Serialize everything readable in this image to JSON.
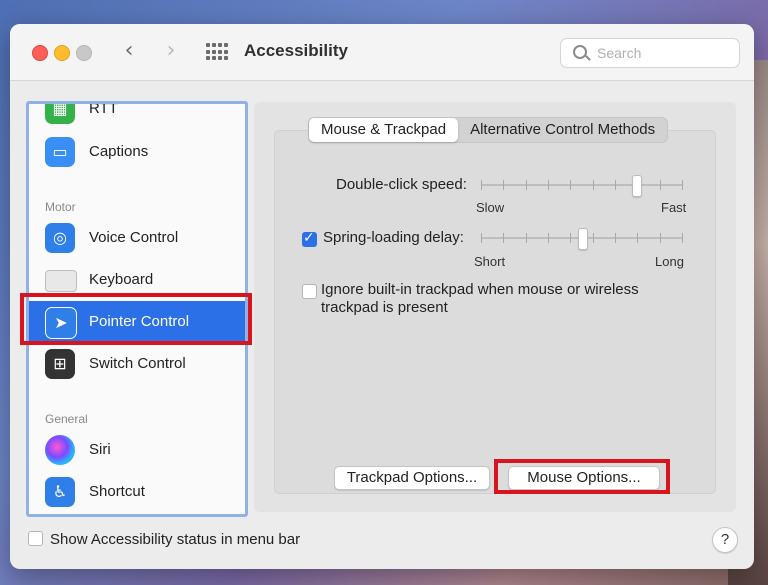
{
  "window": {
    "title": "Accessibility",
    "search_placeholder": "Search",
    "nav_back": "‹",
    "nav_forward": "›"
  },
  "sidebar": {
    "items": [
      {
        "label": "RTT",
        "icon": "rtt-icon"
      },
      {
        "label": "Captions",
        "icon": "captions-icon"
      },
      {
        "label": "Voice Control",
        "icon": "voice-control-icon"
      },
      {
        "label": "Keyboard",
        "icon": "keyboard-icon"
      },
      {
        "label": "Pointer Control",
        "icon": "pointer-icon",
        "selected": true
      },
      {
        "label": "Switch Control",
        "icon": "switch-control-icon"
      },
      {
        "label": "Siri",
        "icon": "siri-icon"
      },
      {
        "label": "Shortcut",
        "icon": "shortcut-icon"
      }
    ],
    "sections": {
      "motor": "Motor",
      "general": "General"
    }
  },
  "tabs": [
    {
      "label": "Mouse & Trackpad",
      "active": true
    },
    {
      "label": "Alternative Control Methods",
      "active": false
    }
  ],
  "settings": {
    "double_click": {
      "label": "Double-click speed:",
      "min_label": "Slow",
      "max_label": "Fast",
      "ticks": 10,
      "value_fraction": 0.78
    },
    "spring_loading": {
      "label": "Spring-loading delay:",
      "checked": true,
      "min_label": "Short",
      "max_label": "Long",
      "ticks": 10,
      "value_fraction": 0.5
    },
    "ignore_trackpad": {
      "label_line1": "Ignore built-in trackpad when mouse or wireless",
      "label_line2": "trackpad is present",
      "checked": false
    }
  },
  "buttons": {
    "trackpad_options": "Trackpad Options...",
    "mouse_options": "Mouse Options..."
  },
  "footer": {
    "status_checkbox_label": "Show Accessibility status in menu bar",
    "status_checked": false,
    "help": "?"
  },
  "colors": {
    "selection": "#2b70e6",
    "highlight_box": "#d8141e",
    "sidebar_border": "#8fb1e8"
  }
}
